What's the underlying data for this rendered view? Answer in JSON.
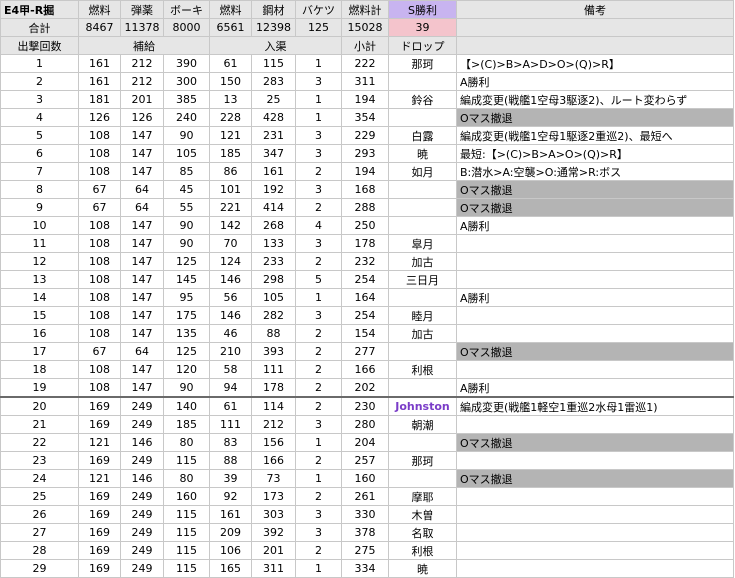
{
  "title": "E4甲-R掘",
  "headers": [
    "燃料",
    "弾薬",
    "ボーキ",
    "燃料",
    "鋼材",
    "バケツ",
    "燃料計",
    "S勝利",
    "備考"
  ],
  "totals": {
    "label": "合計",
    "values": [
      "8467",
      "11378",
      "8000",
      "6561",
      "12398",
      "125",
      "15028",
      "39"
    ]
  },
  "subheaders": {
    "sortie": "出撃回数",
    "resupply": "補給",
    "docking": "入渠",
    "subtotal": "小計",
    "drop": "ドロップ"
  },
  "rows": [
    {
      "n": "1",
      "v": [
        "161",
        "212",
        "390",
        "61",
        "115",
        "1",
        "222"
      ],
      "drop": "那珂",
      "note": "【>(C)>B>A>D>O>(Q)>R】",
      "gray": false
    },
    {
      "n": "2",
      "v": [
        "161",
        "212",
        "300",
        "150",
        "283",
        "3",
        "311"
      ],
      "drop": "",
      "note": "A勝利",
      "gray": false
    },
    {
      "n": "3",
      "v": [
        "181",
        "201",
        "385",
        "13",
        "25",
        "1",
        "194"
      ],
      "drop": "鈴谷",
      "note": "編成変更(戦艦1空母3駆逐2)、ルート変わらず",
      "gray": false
    },
    {
      "n": "4",
      "v": [
        "126",
        "126",
        "240",
        "228",
        "428",
        "1",
        "354"
      ],
      "drop": "",
      "note": "Oマス撤退",
      "gray": true
    },
    {
      "n": "5",
      "v": [
        "108",
        "147",
        "90",
        "121",
        "231",
        "3",
        "229"
      ],
      "drop": "白露",
      "note": "編成変更(戦艦1空母1駆逐2重巡2)、最短へ",
      "gray": false
    },
    {
      "n": "6",
      "v": [
        "108",
        "147",
        "105",
        "185",
        "347",
        "3",
        "293"
      ],
      "drop": "暁",
      "note": "最短:【>(C)>B>A>O>(Q)>R】",
      "gray": false
    },
    {
      "n": "7",
      "v": [
        "108",
        "147",
        "85",
        "86",
        "161",
        "2",
        "194"
      ],
      "drop": "如月",
      "note": "B:潜水>A:空襲>O:通常>R:ボス",
      "gray": false
    },
    {
      "n": "8",
      "v": [
        "67",
        "64",
        "45",
        "101",
        "192",
        "3",
        "168"
      ],
      "drop": "",
      "note": "Oマス撤退",
      "gray": true
    },
    {
      "n": "9",
      "v": [
        "67",
        "64",
        "55",
        "221",
        "414",
        "2",
        "288"
      ],
      "drop": "",
      "note": "Oマス撤退",
      "gray": true
    },
    {
      "n": "10",
      "v": [
        "108",
        "147",
        "90",
        "142",
        "268",
        "4",
        "250"
      ],
      "drop": "",
      "note": "A勝利",
      "gray": false
    },
    {
      "n": "11",
      "v": [
        "108",
        "147",
        "90",
        "70",
        "133",
        "3",
        "178"
      ],
      "drop": "皐月",
      "note": "",
      "gray": false
    },
    {
      "n": "12",
      "v": [
        "108",
        "147",
        "125",
        "124",
        "233",
        "2",
        "232"
      ],
      "drop": "加古",
      "note": "",
      "gray": false
    },
    {
      "n": "13",
      "v": [
        "108",
        "147",
        "145",
        "146",
        "298",
        "5",
        "254"
      ],
      "drop": "三日月",
      "note": "",
      "gray": false
    },
    {
      "n": "14",
      "v": [
        "108",
        "147",
        "95",
        "56",
        "105",
        "1",
        "164"
      ],
      "drop": "",
      "note": "A勝利",
      "gray": false
    },
    {
      "n": "15",
      "v": [
        "108",
        "147",
        "175",
        "146",
        "282",
        "3",
        "254"
      ],
      "drop": "睦月",
      "note": "",
      "gray": false
    },
    {
      "n": "16",
      "v": [
        "108",
        "147",
        "135",
        "46",
        "88",
        "2",
        "154"
      ],
      "drop": "加古",
      "note": "",
      "gray": false
    },
    {
      "n": "17",
      "v": [
        "67",
        "64",
        "125",
        "210",
        "393",
        "2",
        "277"
      ],
      "drop": "",
      "note": "Oマス撤退",
      "gray": true
    },
    {
      "n": "18",
      "v": [
        "108",
        "147",
        "120",
        "58",
        "111",
        "2",
        "166"
      ],
      "drop": "利根",
      "note": "",
      "gray": false
    },
    {
      "n": "19",
      "v": [
        "108",
        "147",
        "90",
        "94",
        "178",
        "2",
        "202"
      ],
      "drop": "",
      "note": "A勝利",
      "gray": false
    },
    {
      "n": "20",
      "v": [
        "169",
        "249",
        "140",
        "61",
        "114",
        "2",
        "230"
      ],
      "drop": "Johnston",
      "note": "編成変更(戦艦1軽空1重巡2水母1雷巡1)",
      "gray": false
    },
    {
      "n": "21",
      "v": [
        "169",
        "249",
        "185",
        "111",
        "212",
        "3",
        "280"
      ],
      "drop": "朝潮",
      "note": "",
      "gray": false
    },
    {
      "n": "22",
      "v": [
        "121",
        "146",
        "80",
        "83",
        "156",
        "1",
        "204"
      ],
      "drop": "",
      "note": "Oマス撤退",
      "gray": true
    },
    {
      "n": "23",
      "v": [
        "169",
        "249",
        "115",
        "88",
        "166",
        "2",
        "257"
      ],
      "drop": "那珂",
      "note": "",
      "gray": false
    },
    {
      "n": "24",
      "v": [
        "121",
        "146",
        "80",
        "39",
        "73",
        "1",
        "160"
      ],
      "drop": "",
      "note": "Oマス撤退",
      "gray": true
    },
    {
      "n": "25",
      "v": [
        "169",
        "249",
        "160",
        "92",
        "173",
        "2",
        "261"
      ],
      "drop": "摩耶",
      "note": "",
      "gray": false
    },
    {
      "n": "26",
      "v": [
        "169",
        "249",
        "115",
        "161",
        "303",
        "3",
        "330"
      ],
      "drop": "木曽",
      "note": "",
      "gray": false
    },
    {
      "n": "27",
      "v": [
        "169",
        "249",
        "115",
        "209",
        "392",
        "3",
        "378"
      ],
      "drop": "名取",
      "note": "",
      "gray": false
    },
    {
      "n": "28",
      "v": [
        "169",
        "249",
        "115",
        "106",
        "201",
        "2",
        "275"
      ],
      "drop": "利根",
      "note": "",
      "gray": false
    },
    {
      "n": "29",
      "v": [
        "169",
        "249",
        "115",
        "165",
        "311",
        "1",
        "334"
      ],
      "drop": "暁",
      "note": "",
      "gray": false
    }
  ]
}
